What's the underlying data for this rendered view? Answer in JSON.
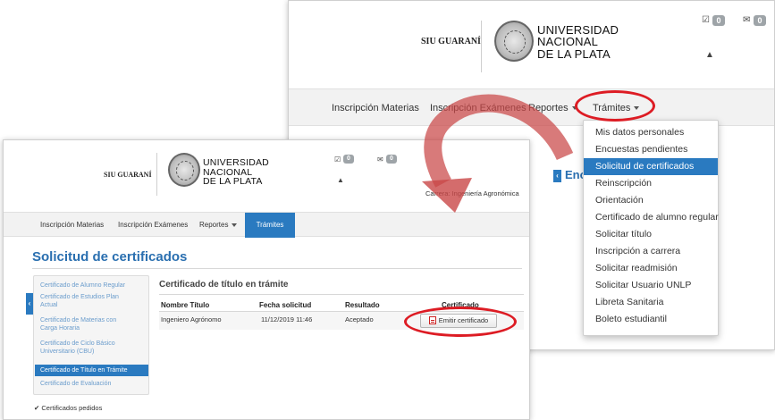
{
  "back_window": {
    "header": {
      "siu_label": "SIU GUARANÍ",
      "university_name": [
        "UNIVERSIDAD",
        "NACIONAL",
        "DE LA PLATA"
      ],
      "messages_count": "0",
      "mail_count": "0",
      "user_icon": "user-icon",
      "messages_icon": "check-square-icon",
      "mail_icon": "envelope-icon"
    },
    "nav": [
      "Inscripción Materias",
      "Inscripción Exámenes",
      "Reportes",
      "Trámites"
    ],
    "dropdown_items": [
      "Mis datos personales",
      "Encuestas pendientes",
      "Solicitud de certificados",
      "Reinscripción",
      "Orientación",
      "Certificado de alumno regular",
      "Solicitar título",
      "Inscripción a carrera",
      "Solicitar readmisión",
      "Solicitar Usuario UNLP",
      "Libreta Sanitaria",
      "Boleto estudiantil"
    ],
    "dropdown_active_index": 2,
    "partial_heading": "Enc"
  },
  "front_window": {
    "header": {
      "siu_label": "SIU GUARANÍ",
      "university_name": [
        "UNIVERSIDAD",
        "NACIONAL",
        "DE LA PLATA"
      ],
      "messages_count": "0",
      "mail_count": "0",
      "career_label": "Carrera: Ingeniería Agronómica"
    },
    "nav": [
      "Inscripción Materias",
      "Inscripción Exámenes",
      "Reportes",
      "Trámites"
    ],
    "page_title": "Solicitud de certificados",
    "sidebar_items": [
      "Certificado de Alumno Regular",
      "Certificado de Estudios Plan Actual",
      "Certificado de Materias con Carga Horaria",
      "Certificado de Ciclo Básico Universitario (CBU)",
      "Certificado de Título en Trámite",
      "Certificado de Evaluación"
    ],
    "sidebar_active_index": 4,
    "section_title": "Certificado de título en trámite",
    "table": {
      "headers": [
        "Nombre Título",
        "Fecha solicitud",
        "Resultado",
        "Certificado"
      ],
      "rows": [
        {
          "title": "Ingeniero Agrónomo",
          "date": "11/12/2019 11:46",
          "result": "Aceptado",
          "action": "Emitir certificado"
        }
      ]
    },
    "footer_link": "Certificados pedidos"
  },
  "colors": {
    "accent_blue": "#2a7ac0",
    "title_blue": "#2a6fb0",
    "highlight_red": "#dd1c24",
    "arrow_red": "#c94747"
  }
}
